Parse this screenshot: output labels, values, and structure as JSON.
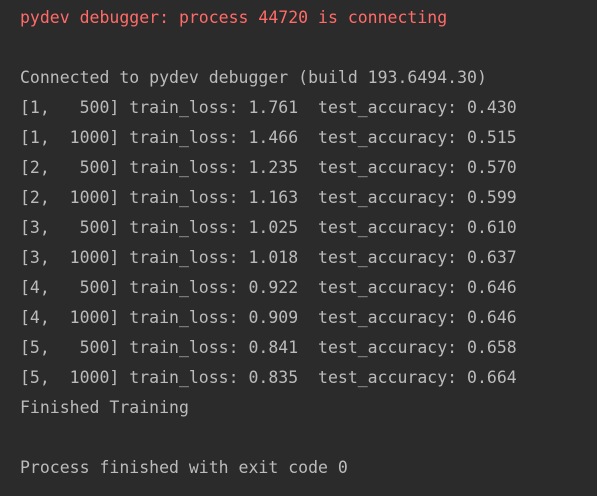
{
  "console": {
    "text_color": "#bbbbbb",
    "error_color": "#ff6b68",
    "background": "#2b2b2b",
    "lines": [
      {
        "kind": "error",
        "text": "pydev debugger: process 44720 is connecting"
      },
      {
        "kind": "blank",
        "text": ""
      },
      {
        "kind": "output",
        "text": "Connected to pydev debugger (build 193.6494.30)"
      },
      {
        "kind": "output",
        "text": "[1,   500] train_loss: 1.761  test_accuracy: 0.430"
      },
      {
        "kind": "output",
        "text": "[1,  1000] train_loss: 1.466  test_accuracy: 0.515"
      },
      {
        "kind": "output",
        "text": "[2,   500] train_loss: 1.235  test_accuracy: 0.570"
      },
      {
        "kind": "output",
        "text": "[2,  1000] train_loss: 1.163  test_accuracy: 0.599"
      },
      {
        "kind": "output",
        "text": "[3,   500] train_loss: 1.025  test_accuracy: 0.610"
      },
      {
        "kind": "output",
        "text": "[3,  1000] train_loss: 1.018  test_accuracy: 0.637"
      },
      {
        "kind": "output",
        "text": "[4,   500] train_loss: 0.922  test_accuracy: 0.646"
      },
      {
        "kind": "output",
        "text": "[4,  1000] train_loss: 0.909  test_accuracy: 0.646"
      },
      {
        "kind": "output",
        "text": "[5,   500] train_loss: 0.841  test_accuracy: 0.658"
      },
      {
        "kind": "output",
        "text": "[5,  1000] train_loss: 0.835  test_accuracy: 0.664"
      },
      {
        "kind": "output",
        "text": "Finished Training"
      },
      {
        "kind": "blank",
        "text": ""
      },
      {
        "kind": "output",
        "text": "Process finished with exit code 0"
      }
    ]
  }
}
